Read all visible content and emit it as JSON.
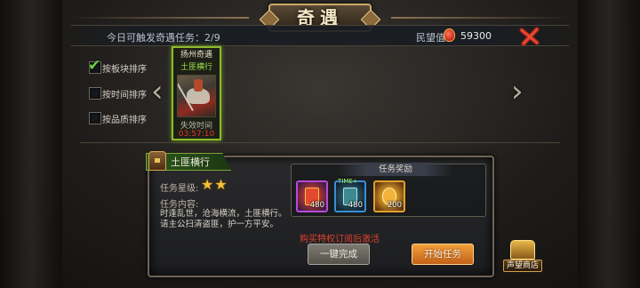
{
  "title": "奇遇",
  "info_bar": {
    "trigger_label": "今日可触发奇遇任务：",
    "trigger_count": "2/9",
    "prestige_label": "民望值",
    "prestige_value": "59300"
  },
  "sort_options": [
    {
      "label": "按板块排序",
      "checked": true
    },
    {
      "label": "按时间排序",
      "checked": false
    },
    {
      "label": "按品质排序",
      "checked": false
    }
  ],
  "quest_card": {
    "title_line1": "扬州奇遇",
    "title_line2": "土匪横行",
    "expire_label": "失效时间",
    "expire_time": "03:57:10"
  },
  "detail": {
    "quest_name": "土匪横行",
    "star_label": "任务星级:",
    "stars": "★★",
    "content_label": "任务内容:",
    "description": "时逢乱世，沧海横流，土匪横行。请主公扫清盗匪，护一方平安。"
  },
  "rewards": {
    "title": "任务奖励",
    "items": [
      {
        "qty": "480",
        "badge": ""
      },
      {
        "qty": "480",
        "badge": "TIME+"
      },
      {
        "qty": "200",
        "badge": ""
      }
    ]
  },
  "subscribe_text": "购买特权订阅后激活",
  "buttons": {
    "quick_complete": "一键完成",
    "start_quest": "开始任务"
  },
  "shop_label": "声望商店",
  "colors": {
    "accent_green": "#8dbb2c",
    "warning_red": "#e0412e",
    "start_orange": "#f2a03a"
  }
}
